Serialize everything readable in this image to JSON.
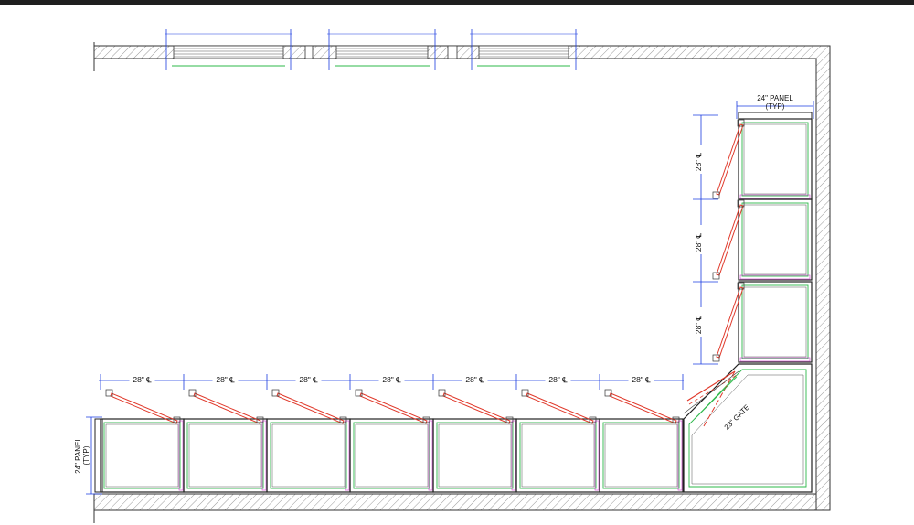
{
  "plan": {
    "row_spacing_label": "28\" ℄",
    "col_spacing_label": "28\" ℄",
    "panel_top_label": [
      "24\" PANEL",
      "(TYP)"
    ],
    "panel_left_label": [
      "24\" PANEL",
      "(TYP)"
    ],
    "gate_label": "23\" GATE",
    "colors": {
      "wall_hatch": "#9a9a9a",
      "panel_outline": "#222222",
      "kennel_liner": "#2db84a",
      "door_red": "#e0392b",
      "dimension_blue": "#1a3be0",
      "magenta": "#d13bd1"
    }
  },
  "edge_glyph": "t"
}
